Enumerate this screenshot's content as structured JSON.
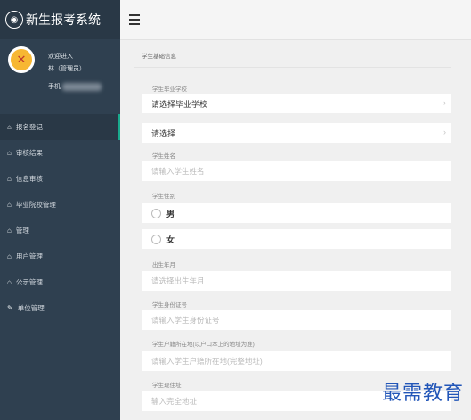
{
  "app": {
    "title": "新生报考系统"
  },
  "profile": {
    "greeting": "欢迎进入",
    "name": "林（管理员）",
    "phone_label": "手机"
  },
  "menu": [
    {
      "label": "报名登记",
      "icon": "home-icon",
      "active": true
    },
    {
      "label": "审核结果",
      "icon": "home-icon"
    },
    {
      "label": "信息审核",
      "icon": "home-icon"
    },
    {
      "label": "毕业院校管理",
      "icon": "home-icon"
    },
    {
      "label": "管理",
      "icon": "home-icon"
    },
    {
      "label": "用户管理",
      "icon": "home-icon"
    },
    {
      "label": "公示管理",
      "icon": "home-icon"
    },
    {
      "label": "单位管理",
      "icon": "edit-icon"
    }
  ],
  "form": {
    "section_title": "学生基础信息",
    "school_label": "学生毕业学校",
    "school_value": "请选择毕业学校",
    "select_value": "请选择",
    "name_label": "学生姓名",
    "name_placeholder": "请输入学生姓名",
    "gender_label": "学生性别",
    "gender_male": "男",
    "gender_female": "女",
    "birth_label": "出生年月",
    "birth_placeholder": "请选择出生年月",
    "id_label": "学生身份证号",
    "id_placeholder": "请输入学生身份证号",
    "hukou_label": "学生户籍所在地(以户口本上的地址为准)",
    "hukou_placeholder": "请输入学生户籍所在地(完整地址)",
    "address_label": "学生现住址",
    "address_placeholder": "输入完全地址"
  },
  "watermark": "最需教育"
}
